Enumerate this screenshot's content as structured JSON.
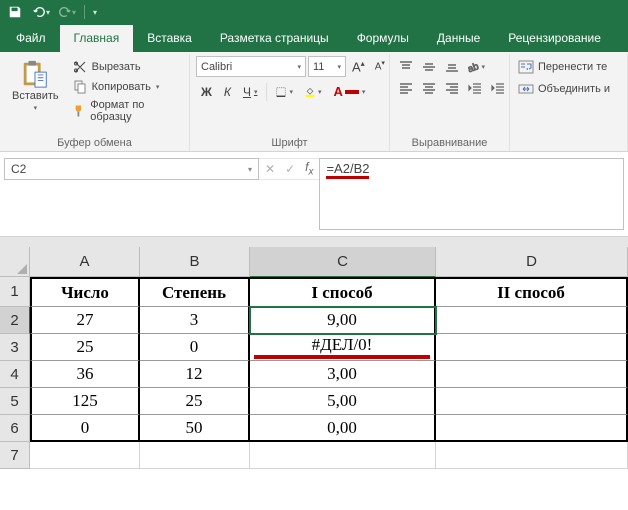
{
  "qat": {
    "save": "save",
    "undo": "undo",
    "redo": "redo"
  },
  "tabs": {
    "file": "Файл",
    "home": "Главная",
    "insert": "Вставка",
    "layout": "Разметка страницы",
    "formulas": "Формулы",
    "data": "Данные",
    "review": "Рецензирование"
  },
  "ribbon": {
    "clipboard": {
      "paste": "Вставить",
      "cut": "Вырезать",
      "copy": "Копировать",
      "format_painter": "Формат по образцу",
      "group_label": "Буфер обмена"
    },
    "font": {
      "name": "Calibri",
      "size": "11",
      "inc": "A",
      "dec": "A",
      "bold": "Ж",
      "italic": "К",
      "underline": "Ч",
      "group_label": "Шрифт"
    },
    "alignment": {
      "group_label": "Выравнивание",
      "wrap": "Перенести те",
      "merge": "Объединить и"
    }
  },
  "name_box": "C2",
  "formula": "=A2/B2",
  "columns": [
    "A",
    "B",
    "C",
    "D"
  ],
  "rows": [
    "1",
    "2",
    "3",
    "4",
    "5",
    "6",
    "7"
  ],
  "grid": {
    "headers": {
      "A1": "Число",
      "B1": "Степень",
      "C1": "I способ",
      "D1": "II способ"
    },
    "data": [
      {
        "A": "27",
        "B": "3",
        "C": "9,00"
      },
      {
        "A": "25",
        "B": "0",
        "C": "#ДЕЛ/0!"
      },
      {
        "A": "36",
        "B": "12",
        "C": "3,00"
      },
      {
        "A": "125",
        "B": "25",
        "C": "5,00"
      },
      {
        "A": "0",
        "B": "50",
        "C": "0,00"
      }
    ]
  },
  "selected_cell": "C2",
  "selected_col": "C",
  "selected_row": "2"
}
